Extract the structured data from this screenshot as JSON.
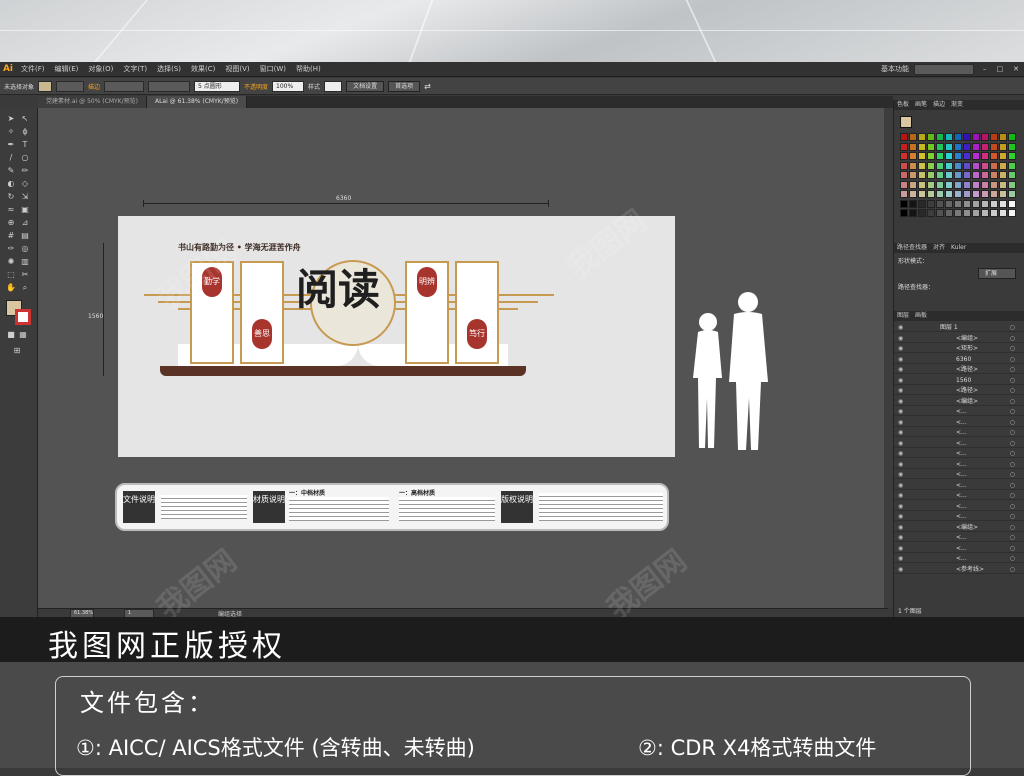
{
  "app": {
    "logo": "Ai",
    "workspace": "基本功能"
  },
  "menu": [
    "文件(F)",
    "编辑(E)",
    "对象(O)",
    "文字(T)",
    "选择(S)",
    "效果(C)",
    "视图(V)",
    "窗口(W)",
    "帮助(H)"
  ],
  "control_bar": {
    "selection_label": "未选择对象",
    "stroke_label": "描边",
    "stroke_value": "5 点圆形",
    "opacity_label": "不透明度",
    "opacity_value": "100%",
    "style_label": "样式",
    "doc_setup": "文档设置",
    "preferences": "首选项"
  },
  "tabs": [
    {
      "label": "党建素材.ai @ 50% (CMYK/预览)",
      "active": false
    },
    {
      "label": "ALai @ 61.38% (CMYK/预览)",
      "active": true
    }
  ],
  "artboard": {
    "dim_width": "6360",
    "dim_height": "1560",
    "headline": "书山有路勤为径 • 学海无涯苦作舟",
    "title": "阅读",
    "panels": [
      "勤学",
      "善思",
      "明辨",
      "笃行"
    ]
  },
  "bottom_panel": {
    "sections": [
      {
        "label": "文件说明"
      },
      {
        "label": "材质说明"
      },
      {
        "heading": "一：中档材质"
      },
      {
        "heading": "一：高档材质"
      },
      {
        "label": "版权说明"
      }
    ]
  },
  "status": {
    "zoom": "61.38%",
    "page": "1",
    "mode": "编组选择"
  },
  "right_panel": {
    "tabs": [
      "色板",
      "画笔",
      "描边",
      "渐变"
    ],
    "pathfinder_tabs": [
      "路径查找器",
      "对齐",
      "Kuler"
    ],
    "shape_mode": "形状模式：",
    "pathfinder": "路径查找器：",
    "expand_btn": "扩展",
    "layers_tabs": [
      "图层",
      "画板"
    ],
    "layers": [
      "图层 1",
      "<编组>",
      "<矩形>",
      "6360",
      "<路径>",
      "1560",
      "<路径>",
      "<编组>",
      "<...",
      "<...",
      "<...",
      "<...",
      "<...",
      "<...",
      "<...",
      "<...",
      "<...",
      "<...",
      "<...",
      "<编组>",
      "<...",
      "<...",
      "<...",
      "<参考线>"
    ],
    "layer_count": "1 个图层"
  },
  "banner": {
    "text": "我图网正版授权"
  },
  "info": {
    "title": "文件包含：",
    "item1": "①: AICC/ AICS格式文件 (含转曲、未转曲)",
    "item2": "②: CDR X4格式转曲文件"
  },
  "watermark": "我图网",
  "colors": {
    "gold": "#c79a52",
    "red": "#a8342e",
    "brown": "#5a3326",
    "accent": "#f7a425"
  }
}
